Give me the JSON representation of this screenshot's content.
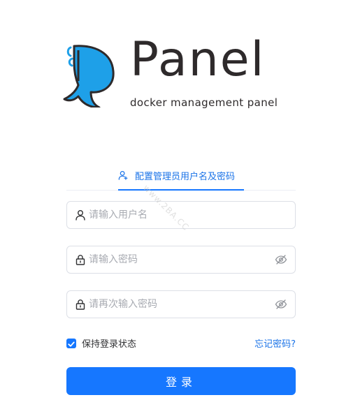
{
  "logo": {
    "wordmark": "Panel",
    "tagline": "docker management panel"
  },
  "tabs": [
    {
      "label": "配置管理员用户名及密码",
      "active": true,
      "icon": "user-plus-icon"
    }
  ],
  "form": {
    "username": {
      "placeholder": "请输入用户名",
      "value": "",
      "icon": "user-icon"
    },
    "password": {
      "placeholder": "请输入密码",
      "value": "",
      "icon": "lock-icon",
      "toggle_icon": "eye-off-icon"
    },
    "confirm_password": {
      "placeholder": "请再次输入密码",
      "value": "",
      "icon": "lock-icon",
      "toggle_icon": "eye-off-icon"
    },
    "remember": {
      "label": "保持登录状态",
      "checked": true
    },
    "forgot_label": "忘记密码?",
    "submit_label": "登录"
  },
  "watermark": "www.2BA.CC",
  "colors": {
    "primary": "#1677ff",
    "logo_blue": "#1ea0e8",
    "text": "#303133",
    "placeholder": "#a8abb2",
    "border": "#dcdfe6"
  }
}
